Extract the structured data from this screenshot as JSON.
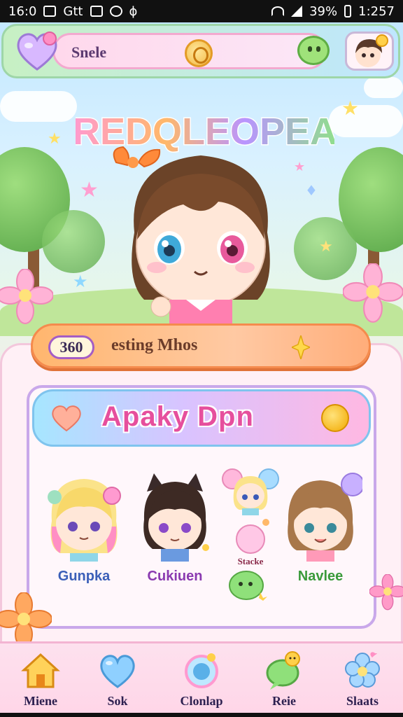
{
  "status_bar": {
    "time": "16:0",
    "left_text": "Gtt",
    "battery": "39%",
    "clock": "1:257"
  },
  "top_bar": {
    "title": "Snele",
    "icons": [
      "heart-icon",
      "coin-icon",
      "chat-icon",
      "avatar-icon"
    ]
  },
  "hero": {
    "title": "REDQLEOPEA"
  },
  "score_banner": {
    "score": "360",
    "text": "esting Mhos"
  },
  "panel": {
    "title": "Apaky Dpn",
    "characters": [
      {
        "name": "Gunpka",
        "color": "#3b5fb8"
      },
      {
        "name": "Cukiuen",
        "color": "#8a3ab0"
      },
      {
        "name": "Navlee",
        "color": "#3a9a3a"
      }
    ],
    "small_label": "Stacke"
  },
  "bottom_nav": {
    "items": [
      {
        "label": "Miene",
        "icon": "home-icon"
      },
      {
        "label": "Sok",
        "icon": "heart-icon"
      },
      {
        "label": "Clonlap",
        "icon": "orb-icon"
      },
      {
        "label": "Reie",
        "icon": "bubble-icon"
      },
      {
        "label": "Slaats",
        "icon": "flower-icon"
      }
    ]
  }
}
